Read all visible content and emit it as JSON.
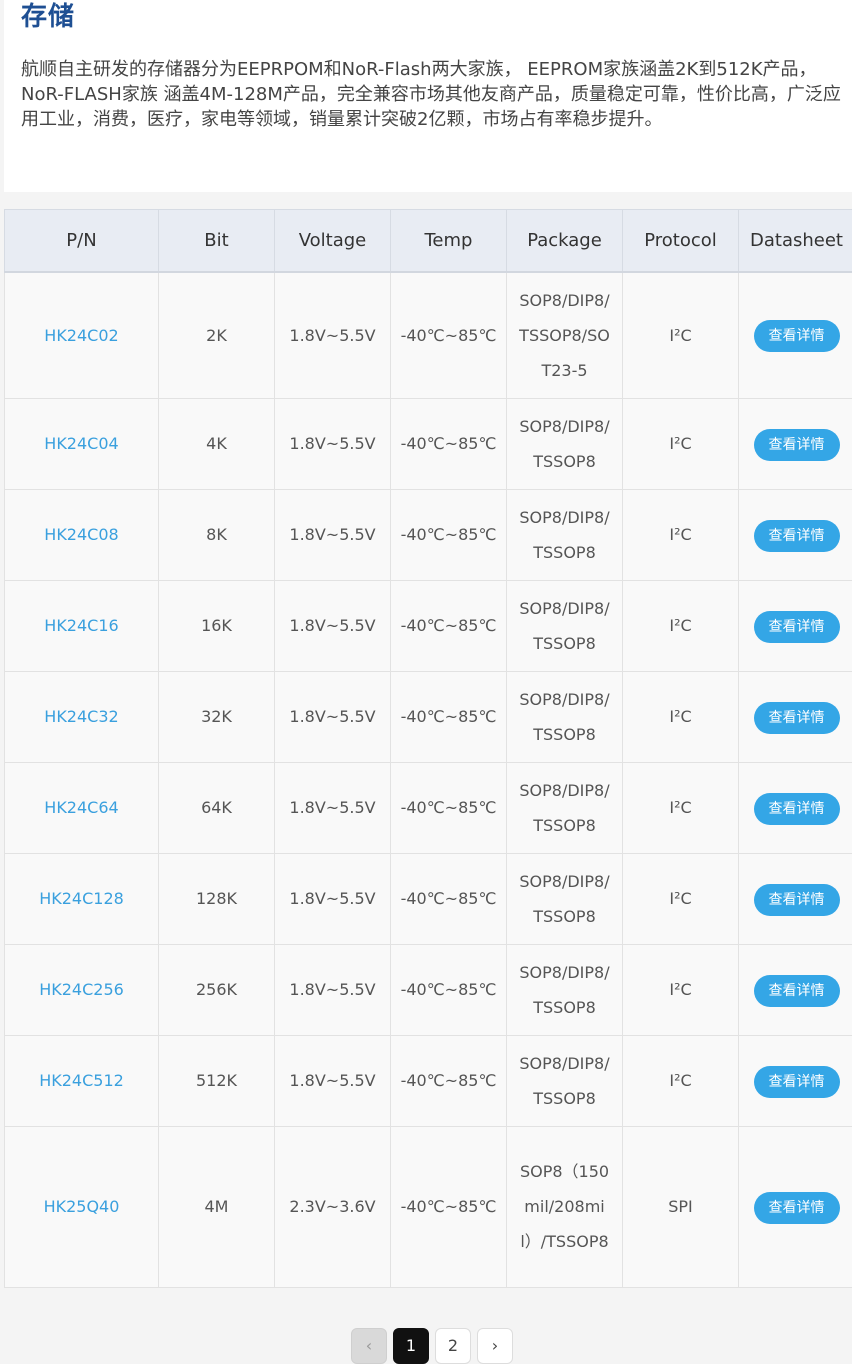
{
  "section": {
    "title": "存储",
    "description": "航顺自主研发的存储器分为EEPRPOM和NoR-Flash两大家族， EEPROM家族涵盖2K到512K产品，NoR-FLASH家族 涵盖4M-128M产品，完全兼容市场其他友商产品，质量稳定可靠，性价比高，广泛应用工业，消费，医疗，家电等领域，销量累计突破2亿颗，市场占有率稳步提升。"
  },
  "table": {
    "headers": [
      "P/N",
      "Bit",
      "Voltage",
      "Temp",
      "Package",
      "Protocol",
      "Datasheet"
    ],
    "button_label": "查看详情",
    "rows": [
      {
        "pn": "HK24C02",
        "bit": "2K",
        "voltage": "1.8V~5.5V",
        "temp": "-40℃~85℃",
        "package": "SOP8/DIP8/TSSOP8/SOT23-5",
        "protocol": "I²C"
      },
      {
        "pn": "HK24C04",
        "bit": "4K",
        "voltage": "1.8V~5.5V",
        "temp": "-40℃~85℃",
        "package": "SOP8/DIP8/TSSOP8",
        "protocol": "I²C"
      },
      {
        "pn": "HK24C08",
        "bit": "8K",
        "voltage": "1.8V~5.5V",
        "temp": "-40℃~85℃",
        "package": "SOP8/DIP8/TSSOP8",
        "protocol": "I²C"
      },
      {
        "pn": "HK24C16",
        "bit": "16K",
        "voltage": "1.8V~5.5V",
        "temp": "-40℃~85℃",
        "package": "SOP8/DIP8/TSSOP8",
        "protocol": "I²C"
      },
      {
        "pn": "HK24C32",
        "bit": "32K",
        "voltage": "1.8V~5.5V",
        "temp": "-40℃~85℃",
        "package": "SOP8/DIP8/TSSOP8",
        "protocol": "I²C"
      },
      {
        "pn": "HK24C64",
        "bit": "64K",
        "voltage": "1.8V~5.5V",
        "temp": "-40℃~85℃",
        "package": "SOP8/DIP8/TSSOP8",
        "protocol": "I²C"
      },
      {
        "pn": "HK24C128",
        "bit": "128K",
        "voltage": "1.8V~5.5V",
        "temp": "-40℃~85℃",
        "package": "SOP8/DIP8/TSSOP8",
        "protocol": "I²C"
      },
      {
        "pn": "HK24C256",
        "bit": "256K",
        "voltage": "1.8V~5.5V",
        "temp": "-40℃~85℃",
        "package": "SOP8/DIP8/TSSOP8",
        "protocol": "I²C"
      },
      {
        "pn": "HK24C512",
        "bit": "512K",
        "voltage": "1.8V~5.5V",
        "temp": "-40℃~85℃",
        "package": "SOP8/DIP8/TSSOP8",
        "protocol": "I²C"
      },
      {
        "pn": "HK25Q40",
        "bit": "4M",
        "voltage": "2.3V~3.6V",
        "temp": "-40℃~85℃",
        "package": "SOP8（150mil/208mil）/TSSOP8",
        "protocol": "SPI"
      }
    ]
  },
  "pagination": {
    "prev_icon": "chevron-left-icon",
    "next_icon": "chevron-right-icon",
    "prev_glyph": "‹",
    "next_glyph": "›",
    "pages": [
      "1",
      "2"
    ],
    "current": "1"
  },
  "colors": {
    "title": "#1e4f93",
    "link": "#3aa0de",
    "button": "#34a6e6",
    "header_bg": "#e8ecf3",
    "active_page": "#111111"
  }
}
